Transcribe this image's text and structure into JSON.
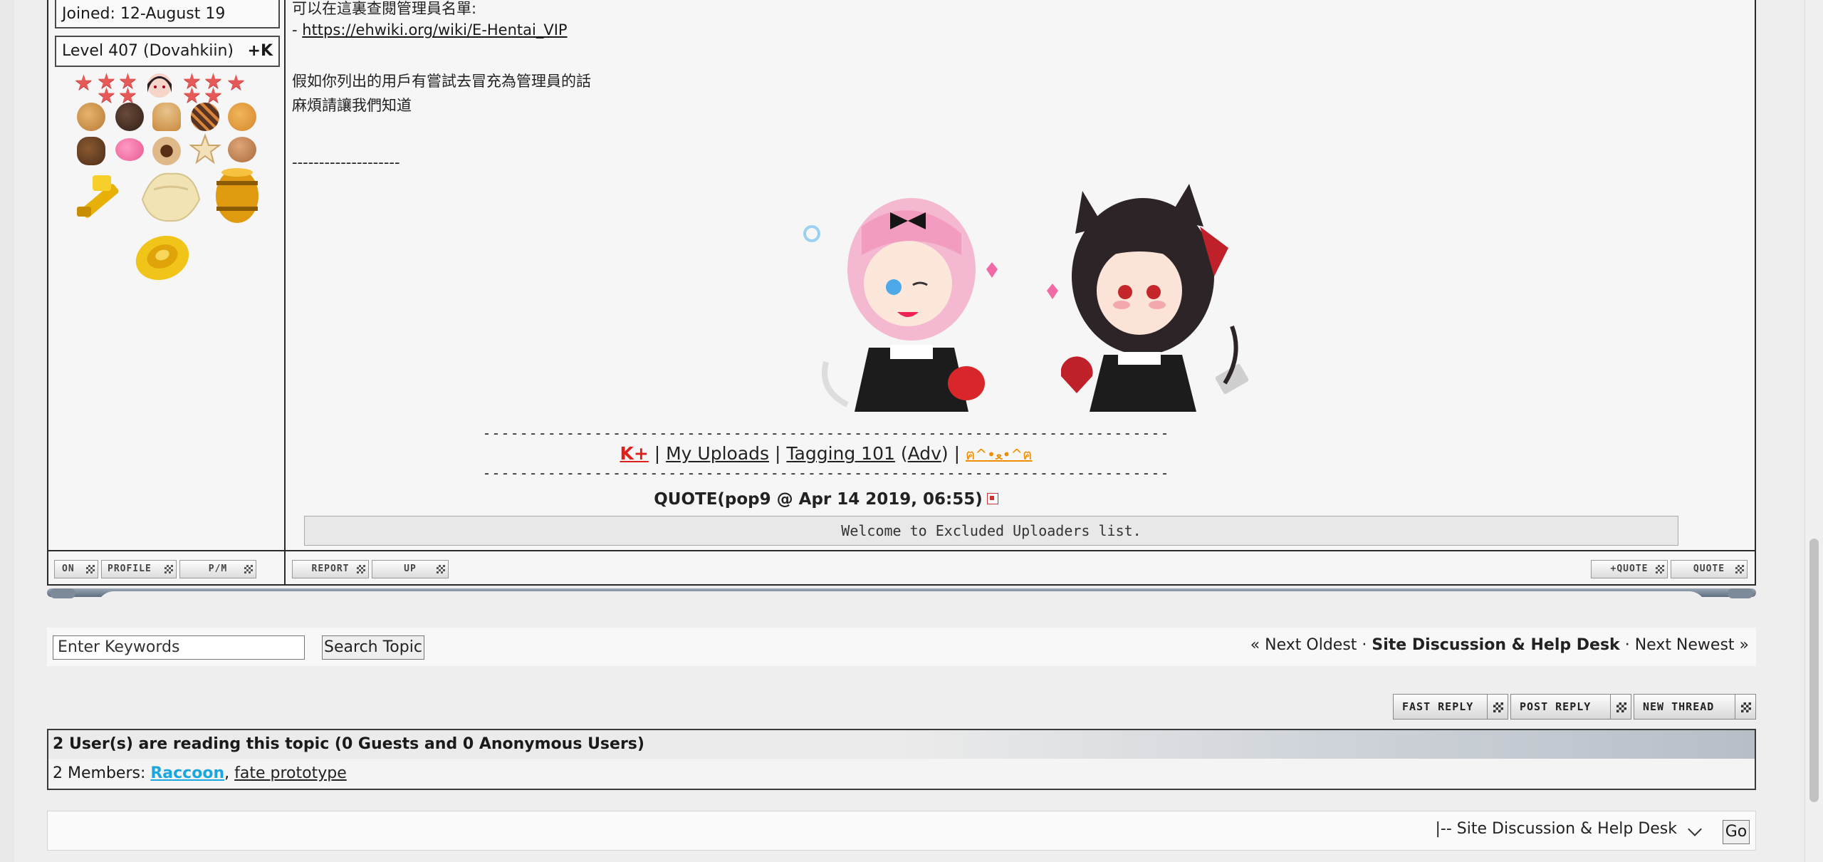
{
  "author_panel": {
    "joined": "Joined: 12-August 19",
    "level": "Level 407 (Dovahkiin)",
    "karma_button": "+K"
  },
  "post": {
    "line1": "可以在這裏查閱管理員名單:",
    "line2_prefix": "- ",
    "line2_link": "https://ehwiki.org/wiki/E-Hentai_VIP",
    "line3": "假如你列出的用戶有嘗試去冒充為管理員的話",
    "line4": "麻煩請讓我們知道",
    "dashes": "--------------------"
  },
  "signature": {
    "rule": "--------------------------------------------------------------------------",
    "k_plus": "K+",
    "sep": " | ",
    "my_uploads": "My Uploads",
    "tagging": "Tagging 101",
    "adv_open": " (",
    "adv": "Adv",
    "adv_close": ") | ",
    "emote": "ฅ^•ﻌ•^ฅ"
  },
  "quote": {
    "header": "QUOTE(pop9 @ Apr 14 2019, 06:55)",
    "text": "Welcome to Excluded Uploaders list."
  },
  "post_buttons": {
    "on": "ON",
    "profile": "PROFILE",
    "pm": "P/M",
    "report": "REPORT",
    "up": "UP",
    "multiquote": "+QUOTE",
    "quote": "QUOTE"
  },
  "search": {
    "placeholder": "Enter Keywords",
    "button": "Search Topic"
  },
  "topic_nav": {
    "prev": "« Next Oldest",
    "dot1": " · ",
    "forum": "Site Discussion & Help Desk",
    "dot2": " · ",
    "next": "Next Newest »"
  },
  "reply_buttons": {
    "fast_reply": "FAST REPLY",
    "post_reply": "POST REPLY",
    "new_thread": "NEW THREAD"
  },
  "active_users": {
    "header": "2 User(s) are reading this topic (0 Guests and 0 Anonymous Users)",
    "members_label": "2 Members: ",
    "member1": "Raccoon",
    "comma": ", ",
    "member2": "fate prototype"
  },
  "forum_jump": {
    "selected": "|-- Site Discussion & Help Desk",
    "go": "Go"
  },
  "colors": {
    "karma_red": "#e0201d",
    "member_highlight": "#1aa7e0",
    "emote_orange": "#f08c00"
  },
  "icons": [
    "star-icon",
    "cookie-icon",
    "badge-icon",
    "quote-link-icon",
    "checker-icon",
    "chevron-down-icon"
  ]
}
